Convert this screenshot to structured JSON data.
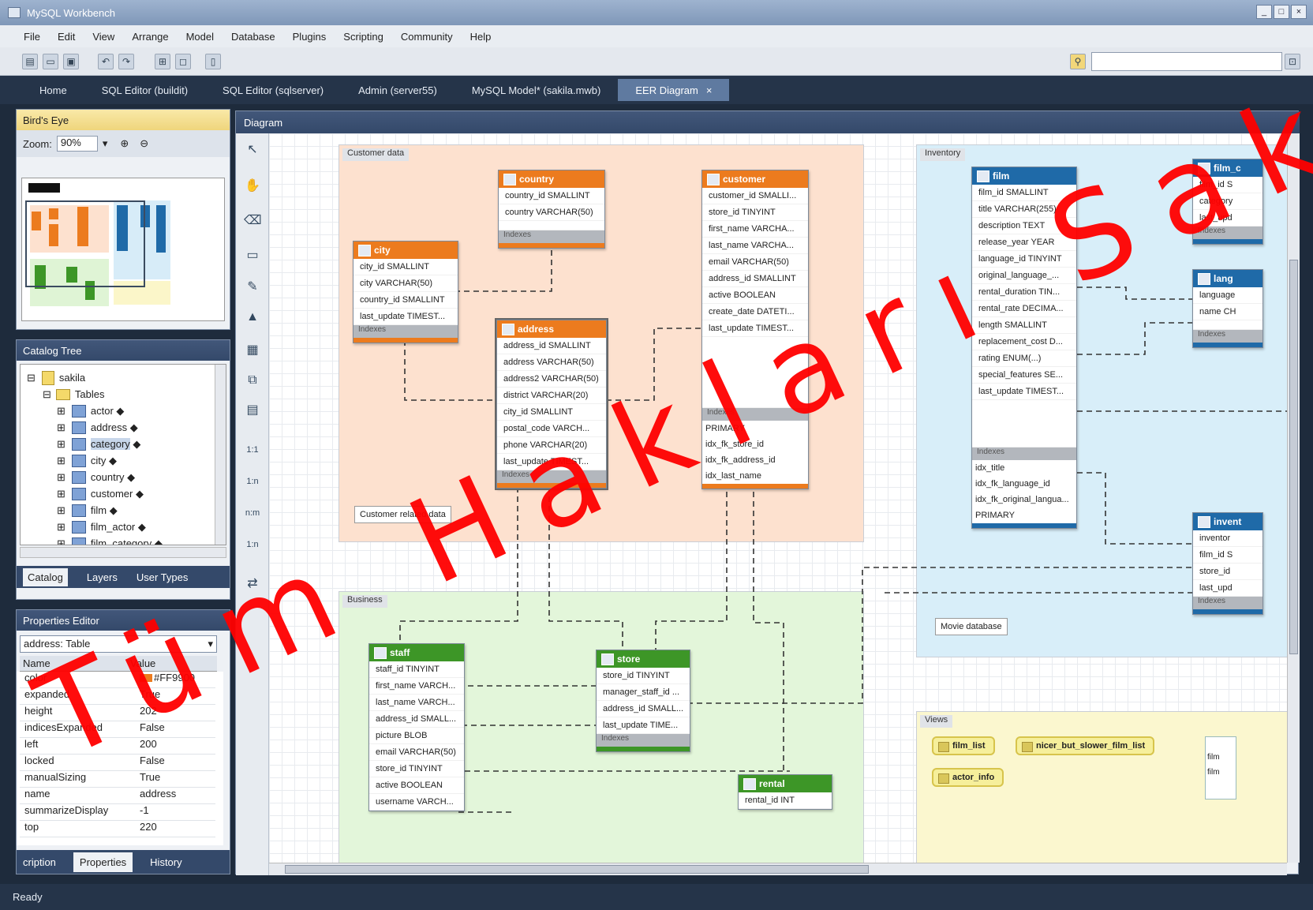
{
  "window": {
    "title": "MySQL Workbench"
  },
  "menu": [
    "File",
    "Edit",
    "View",
    "Arrange",
    "Model",
    "Database",
    "Plugins",
    "Scripting",
    "Community",
    "Help"
  ],
  "tabs": [
    {
      "label": "Home"
    },
    {
      "label": "SQL Editor (buildit)"
    },
    {
      "label": "SQL Editor (sqlserver)"
    },
    {
      "label": "Admin (server55)"
    },
    {
      "label": "MySQL Model* (sakila.mwb)"
    },
    {
      "label": "EER Diagram"
    }
  ],
  "birds_eye": {
    "title": "Bird's Eye",
    "zoom_label": "Zoom:",
    "zoom_value": "90%"
  },
  "catalog": {
    "title": "Catalog Tree",
    "schema": "sakila",
    "folder": "Tables",
    "tables": [
      "actor",
      "address",
      "category",
      "city",
      "country",
      "customer",
      "film",
      "film_actor",
      "film_category"
    ],
    "bottom_tabs": [
      "Catalog",
      "Layers",
      "User Types"
    ]
  },
  "properties": {
    "title": "Properties Editor",
    "selected": "address: Table",
    "col_name": "Name",
    "col_value": "Value",
    "rows": [
      {
        "k": "color",
        "v": "#FF9900"
      },
      {
        "k": "expanded",
        "v": "True"
      },
      {
        "k": "height",
        "v": "202"
      },
      {
        "k": "indicesExpanded",
        "v": "False"
      },
      {
        "k": "left",
        "v": "200"
      },
      {
        "k": "locked",
        "v": "False"
      },
      {
        "k": "manualSizing",
        "v": "True"
      },
      {
        "k": "name",
        "v": "address"
      },
      {
        "k": "summarizeDisplay",
        "v": "-1"
      },
      {
        "k": "top",
        "v": "220"
      }
    ],
    "bottom_tabs": [
      "cription",
      "Properties",
      "History"
    ]
  },
  "diagram": {
    "title": "Diagram",
    "layers": [
      {
        "label": "Customer data"
      },
      {
        "label": "Business"
      },
      {
        "label": "Inventory"
      },
      {
        "label": "Views"
      }
    ],
    "notes": {
      "customer": "Customer related data",
      "movie": "Movie database"
    },
    "tables": {
      "country": {
        "name": "country",
        "cols": [
          "country_id SMALLINT",
          "country VARCHAR(50)"
        ],
        "idx_label": "Indexes"
      },
      "city": {
        "name": "city",
        "cols": [
          "city_id SMALLINT",
          "city VARCHAR(50)",
          "country_id SMALLINT",
          "last_update TIMEST..."
        ],
        "idx_label": "Indexes"
      },
      "address": {
        "name": "address",
        "cols": [
          "address_id SMALLINT",
          "address VARCHAR(50)",
          "address2 VARCHAR(50)",
          "district VARCHAR(20)",
          "city_id SMALLINT",
          "postal_code VARCH...",
          "phone VARCHAR(20)",
          "last_update TIMEST..."
        ],
        "idx_label": "Indexes"
      },
      "customer": {
        "name": "customer",
        "cols": [
          "customer_id SMALLI...",
          "store_id TINYINT",
          "first_name VARCHA...",
          "last_name VARCHA...",
          "email VARCHAR(50)",
          "address_id SMALLINT",
          "active BOOLEAN",
          "create_date DATETI...",
          "last_update TIMEST..."
        ],
        "idx_label": "Indexes",
        "idx": [
          "PRIMARY",
          "idx_fk_store_id",
          "idx_fk_address_id",
          "idx_last_name"
        ]
      },
      "film": {
        "name": "film",
        "cols": [
          "film_id SMALLINT",
          "title VARCHAR(255)",
          "description TEXT",
          "release_year YEAR",
          "language_id TINYINT",
          "original_language_...",
          "rental_duration TIN...",
          "rental_rate DECIMA...",
          "length SMALLINT",
          "replacement_cost D...",
          "rating ENUM(...)",
          "special_features SE...",
          "last_update TIMEST..."
        ],
        "idx_label": "Indexes",
        "idx": [
          "idx_title",
          "idx_fk_language_id",
          "idx_fk_original_langua...",
          "PRIMARY"
        ]
      },
      "staff": {
        "name": "staff",
        "cols": [
          "staff_id TINYINT",
          "first_name VARCH...",
          "last_name VARCH...",
          "address_id SMALL...",
          "picture BLOB",
          "email VARCHAR(50)",
          "store_id TINYINT",
          "active BOOLEAN",
          "username VARCH..."
        ]
      },
      "store": {
        "name": "store",
        "cols": [
          "store_id TINYINT",
          "manager_staff_id ...",
          "address_id SMALL...",
          "last_update TIME..."
        ],
        "idx_label": "Indexes"
      },
      "rental": {
        "name": "rental",
        "cols": [
          "rental_id INT"
        ]
      },
      "film_cat": {
        "name": "film_c",
        "cols": [
          "film_id S",
          "category",
          "last_upd"
        ],
        "idx_label": "Indexes"
      },
      "language": {
        "name": "lang",
        "cols": [
          "language",
          "name CH"
        ],
        "idx_label": "Indexes"
      },
      "inventory": {
        "name": "invent",
        "cols": [
          "inventor",
          "film_id S",
          "store_id",
          "last_upd"
        ],
        "idx_label": "Indexes"
      }
    },
    "views": [
      "film_list",
      "nicer_but_slower_film_list",
      "actor_info"
    ],
    "views_side": [
      "film",
      "film"
    ]
  },
  "status": "Ready",
  "watermark": "Tüm Hakları Saklıdır"
}
